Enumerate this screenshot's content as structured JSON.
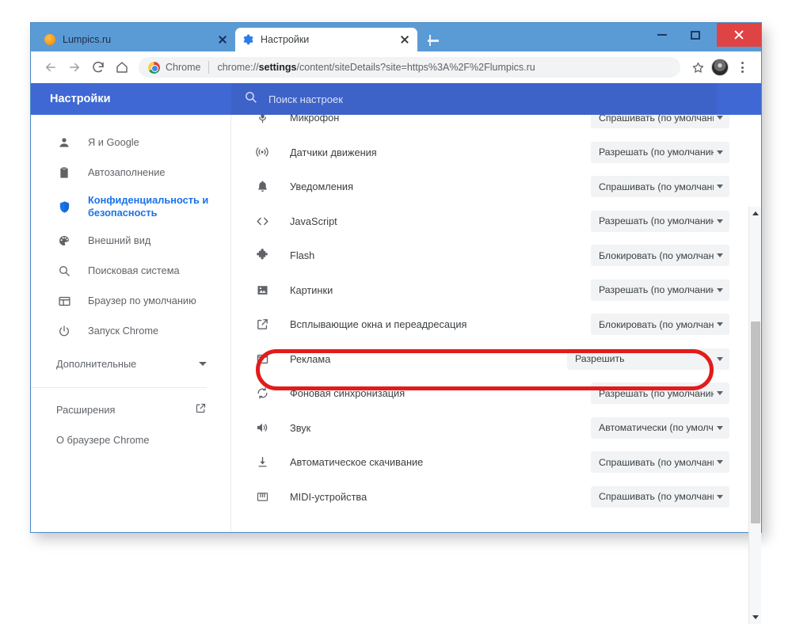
{
  "window": {
    "minimize_label": "Свернуть",
    "maximize_label": "Развернуть",
    "close_label": "Закрыть"
  },
  "tabs": [
    {
      "title": "Lumpics.ru",
      "favicon": "orange-dot-icon",
      "active": false
    },
    {
      "title": "Настройки",
      "favicon": "gear-icon",
      "active": true
    }
  ],
  "newtab_label": "+",
  "toolbar": {
    "back_label": "Назад",
    "forward_label": "Вперёд",
    "reload_label": "Обновить",
    "home_label": "Главная",
    "chrome_badge": "Chrome",
    "url_prefix": "chrome://",
    "url_bold": "settings",
    "url_suffix": "/content/siteDetails?site=https%3A%2F%2Flumpics.ru",
    "url_full": "chrome://settings/content/siteDetails?site=https%3A%2F%2Flumpics.ru",
    "bookmark_label": "В закладки",
    "profile_label": "Профиль",
    "menu_label": "Настройка и управление Google Chrome"
  },
  "settings": {
    "title": "Настройки",
    "search_placeholder": "Поиск настроек"
  },
  "sidebar": {
    "items": [
      {
        "label": "Я и Google",
        "icon": "person-icon",
        "active": false
      },
      {
        "label": "Автозаполнение",
        "icon": "clipboard-icon",
        "active": false
      },
      {
        "label": "Конфиденциальность и безопасность",
        "icon": "shield-icon",
        "active": true
      },
      {
        "label": "Внешний вид",
        "icon": "palette-icon",
        "active": false
      },
      {
        "label": "Поисковая система",
        "icon": "search-icon",
        "active": false
      },
      {
        "label": "Браузер по умолчанию",
        "icon": "browser-window-icon",
        "active": false
      },
      {
        "label": "Запуск Chrome",
        "icon": "power-icon",
        "active": false
      }
    ],
    "advanced": {
      "label": "Дополнительные",
      "icon": "chevron-down-icon"
    },
    "extras": [
      {
        "label": "Расширения",
        "icon": "external-link-icon"
      },
      {
        "label": "О браузере Chrome",
        "icon": ""
      }
    ]
  },
  "permissions": {
    "rows": [
      {
        "label": "Микрофон",
        "icon": "microphone-icon",
        "value": "Спрашивать (по умолчанию)",
        "highlighted": false
      },
      {
        "label": "Датчики движения",
        "icon": "motion-sensor-icon",
        "value": "Разрешать (по умолчанию)",
        "highlighted": false
      },
      {
        "label": "Уведомления",
        "icon": "bell-icon",
        "value": "Спрашивать (по умолчанию)",
        "highlighted": false
      },
      {
        "label": "JavaScript",
        "icon": "code-brackets-icon",
        "value": "Разрешать (по умолчанию)",
        "highlighted": false
      },
      {
        "label": "Flash",
        "icon": "puzzle-icon",
        "value": "Блокировать (по умолчанию)",
        "highlighted": false
      },
      {
        "label": "Картинки",
        "icon": "image-icon",
        "value": "Разрешать (по умолчанию)",
        "highlighted": false
      },
      {
        "label": "Всплывающие окна и переадресация",
        "icon": "external-link-icon",
        "value": "Блокировать (по умолчанию)",
        "highlighted": false
      },
      {
        "label": "Реклама",
        "icon": "window-rect-icon",
        "value": "Разрешить",
        "highlighted": true
      },
      {
        "label": "Фоновая синхронизация",
        "icon": "sync-icon",
        "value": "Разрешать (по умолчанию)",
        "highlighted": false
      },
      {
        "label": "Звук",
        "icon": "speaker-icon",
        "value": "Автоматически (по умолчанию)",
        "highlighted": false
      },
      {
        "label": "Автоматическое скачивание",
        "icon": "download-icon",
        "value": "Спрашивать (по умолчанию)",
        "highlighted": false
      },
      {
        "label": "MIDI-устройства",
        "icon": "midi-keyboard-icon",
        "value": "Спрашивать (по умолчанию)",
        "highlighted": false
      }
    ]
  },
  "annotation": {
    "color": "#e21b1b",
    "target": "Реклама"
  },
  "colors": {
    "window_frame": "#5b9bd5",
    "settings_header": "#3f68d4",
    "accent_blue": "#1a73e8",
    "close_button": "#e04343",
    "select_bg": "#f1f3f4"
  }
}
